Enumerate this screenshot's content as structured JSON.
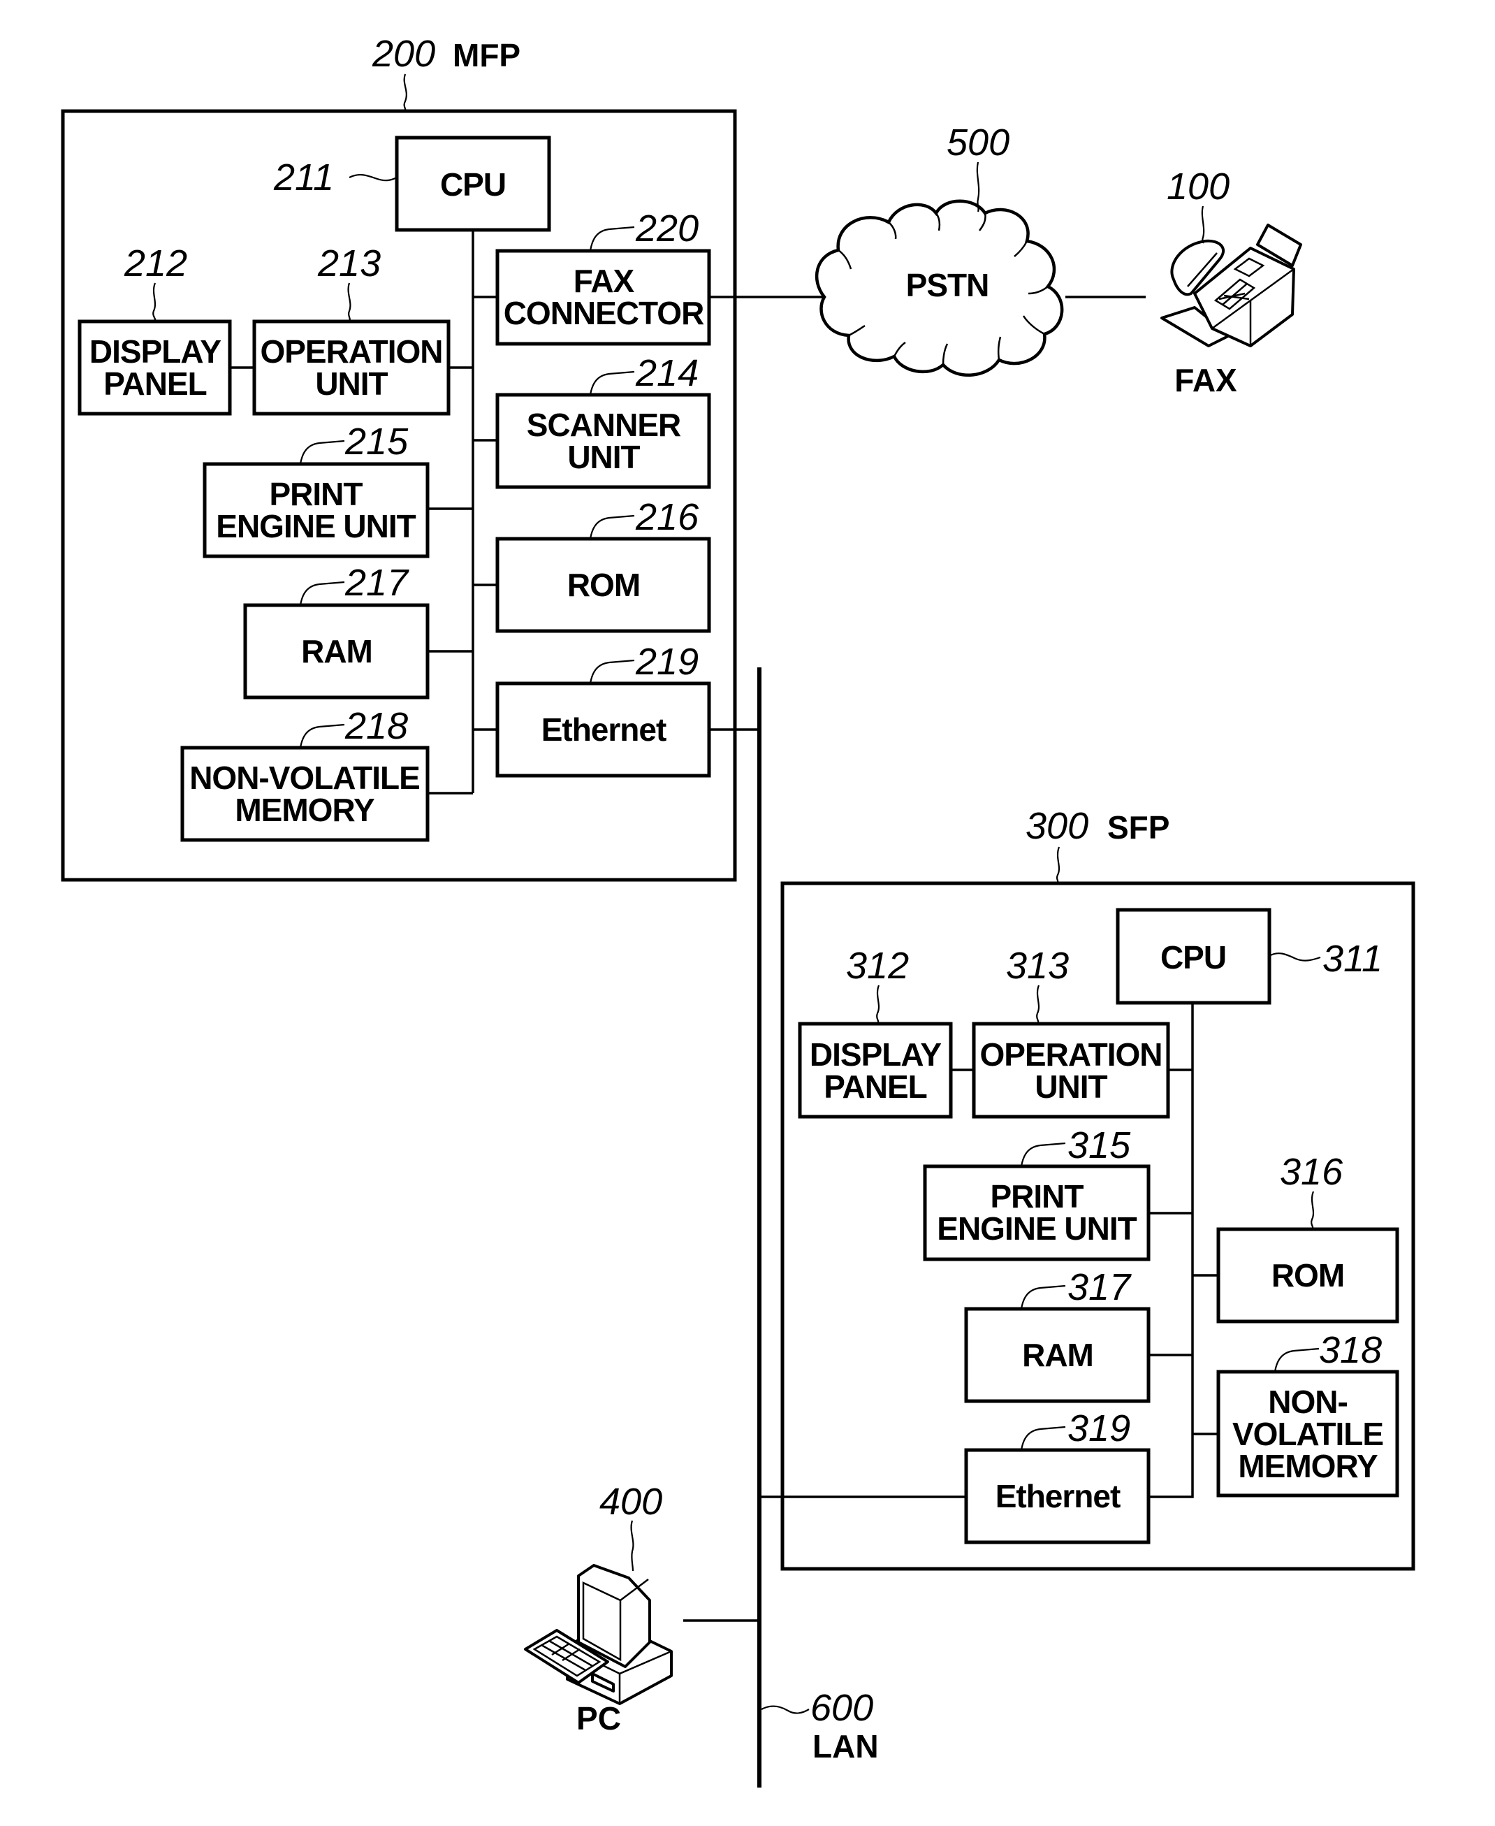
{
  "figure": {
    "mfp": {
      "ref": "200",
      "title": "MFP",
      "components": {
        "cpu": {
          "ref": "211",
          "lines": [
            "CPU"
          ]
        },
        "display_panel": {
          "ref": "212",
          "lines": [
            "DISPLAY",
            "PANEL"
          ]
        },
        "operation_unit": {
          "ref": "213",
          "lines": [
            "OPERATION",
            "UNIT"
          ]
        },
        "scanner_unit": {
          "ref": "214",
          "lines": [
            "SCANNER",
            "UNIT"
          ]
        },
        "print_engine_unit": {
          "ref": "215",
          "lines": [
            "PRINT",
            "ENGINE UNIT"
          ]
        },
        "rom": {
          "ref": "216",
          "lines": [
            "ROM"
          ]
        },
        "ram": {
          "ref": "217",
          "lines": [
            "RAM"
          ]
        },
        "non_volatile_memory": {
          "ref": "218",
          "lines": [
            "NON-VOLATILE",
            "MEMORY"
          ]
        },
        "ethernet": {
          "ref": "219",
          "lines": [
            "Ethernet"
          ]
        },
        "fax_connector": {
          "ref": "220",
          "lines": [
            "FAX",
            "CONNECTOR"
          ]
        }
      }
    },
    "sfp": {
      "ref": "300",
      "title": "SFP",
      "components": {
        "cpu": {
          "ref": "311",
          "lines": [
            "CPU"
          ]
        },
        "display_panel": {
          "ref": "312",
          "lines": [
            "DISPLAY",
            "PANEL"
          ]
        },
        "operation_unit": {
          "ref": "313",
          "lines": [
            "OPERATION",
            "UNIT"
          ]
        },
        "print_engine_unit": {
          "ref": "315",
          "lines": [
            "PRINT",
            "ENGINE UNIT"
          ]
        },
        "rom": {
          "ref": "316",
          "lines": [
            "ROM"
          ]
        },
        "ram": {
          "ref": "317",
          "lines": [
            "RAM"
          ]
        },
        "non_volatile_memory": {
          "ref": "318",
          "lines": [
            "NON-",
            "VOLATILE",
            "MEMORY"
          ]
        },
        "ethernet": {
          "ref": "319",
          "lines": [
            "Ethernet"
          ]
        }
      }
    },
    "pstn": {
      "ref": "500",
      "label": "PSTN"
    },
    "fax": {
      "ref": "100",
      "label": "FAX",
      "icon": "fax-machine-icon"
    },
    "pc": {
      "ref": "400",
      "label": "PC",
      "icon": "desktop-computer-icon"
    },
    "lan": {
      "ref": "600",
      "label": "LAN"
    }
  }
}
